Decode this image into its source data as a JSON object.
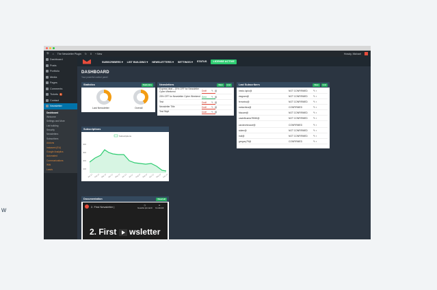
{
  "side_text": "w",
  "adminbar": {
    "site": "The Newsletter Plugin",
    "counts": "0",
    "new_label": "+ New",
    "user": "Howdy, Michael"
  },
  "sidebar": {
    "items": [
      {
        "label": "Dashboard"
      },
      {
        "label": "Posts"
      },
      {
        "label": "Portfolio"
      },
      {
        "label": "Media"
      },
      {
        "label": "Pages"
      },
      {
        "label": "Comments"
      },
      {
        "label": "Tickets",
        "badge": "5"
      },
      {
        "label": "Contact"
      },
      {
        "label": "Newsletter"
      }
    ],
    "submenu": [
      "Dashboard",
      "Welcome",
      "Settings and More",
      "List building",
      "Security",
      "Newsletters",
      "Subscribers",
      "Addons",
      "Instasent (EU)",
      "Google Analytics",
      "Automated",
      "Communications",
      "Wiki",
      "Leads"
    ]
  },
  "topnav": {
    "items": [
      "SUBSCRIBERS ▾",
      "LIST BUILDING ▾",
      "NEWSLETTERS ▾",
      "SETTINGS ▾",
      "STATUS"
    ],
    "license_btn": "LICENSE ACTIVE"
  },
  "page": {
    "title": "DASHBOARD",
    "subtitle": "Your powerful control panel"
  },
  "statistics": {
    "title": "Statistics",
    "button": "Statistics",
    "donut1_label": "Last Newsletter",
    "donut2_label": "Overall",
    "colors": {
      "orange": "#f39c12",
      "grey": "#d5d8dc"
    }
  },
  "newsletters": {
    "title": "Newsletters",
    "new_btn": "New",
    "list_btn": "List",
    "rows": [
      {
        "name": "Express deal – 20% OFF for Newsletter Cyber Weekend",
        "status": "Draft"
      },
      {
        "name": "20% OFF for Newsletter Cyber Weekend",
        "status": "Sent"
      },
      {
        "name": "Test",
        "status": "Draft"
      },
      {
        "name": "Newsletter Title",
        "status": "Draft"
      },
      {
        "name": "Test 9bytt",
        "status": "Draft"
      }
    ]
  },
  "subscribers": {
    "title": "Last Subscribers",
    "new_btn": "New",
    "list_btn": "List",
    "rows": [
      {
        "email": "nesto.lupio@",
        "status": "NOT CONFIRMED"
      },
      {
        "email": "viagram@",
        "status": "NOT CONFIRMED"
      },
      {
        "email": "ferrarino@",
        "status": "NOT CONFIRMED"
      },
      {
        "email": "melachina@",
        "status": "CONFIRMED"
      },
      {
        "email": "fdscare@",
        "status": "NOT CONFIRMED"
      },
      {
        "email": "castellicania78945@",
        "status": "NOT CONFIRMED"
      },
      {
        "email": "carolechinacof@",
        "status": "CONFIRMED"
      },
      {
        "email": "stderr@",
        "status": "NOT CONFIRMED"
      },
      {
        "email": "indi@",
        "status": "NOT CONFIRMED"
      },
      {
        "email": "gregory79@",
        "status": "CONFIRMED"
      }
    ]
  },
  "subscriptions": {
    "title": "Subscriptions",
    "legend": "Subscriptions",
    "yticks": [
      "400",
      "300",
      "200",
      "100"
    ],
    "xlabels": [
      "Jan 17",
      "Feb 17",
      "Mar 17",
      "Apr 17",
      "May 17",
      "Jun 17",
      "Jul 17",
      "Aug 17",
      "Sep 17",
      "Oct 17",
      "Nov 17",
      "Dec 17"
    ],
    "color": "#2ecc71"
  },
  "documentation": {
    "title": "Documentation",
    "button": "Read all",
    "video_title": "2. First Newsletter |",
    "watch_later": "Guarda più tardi",
    "share": "Condividi",
    "big_text_left": "2. First",
    "big_text_right": "wsletter"
  }
}
